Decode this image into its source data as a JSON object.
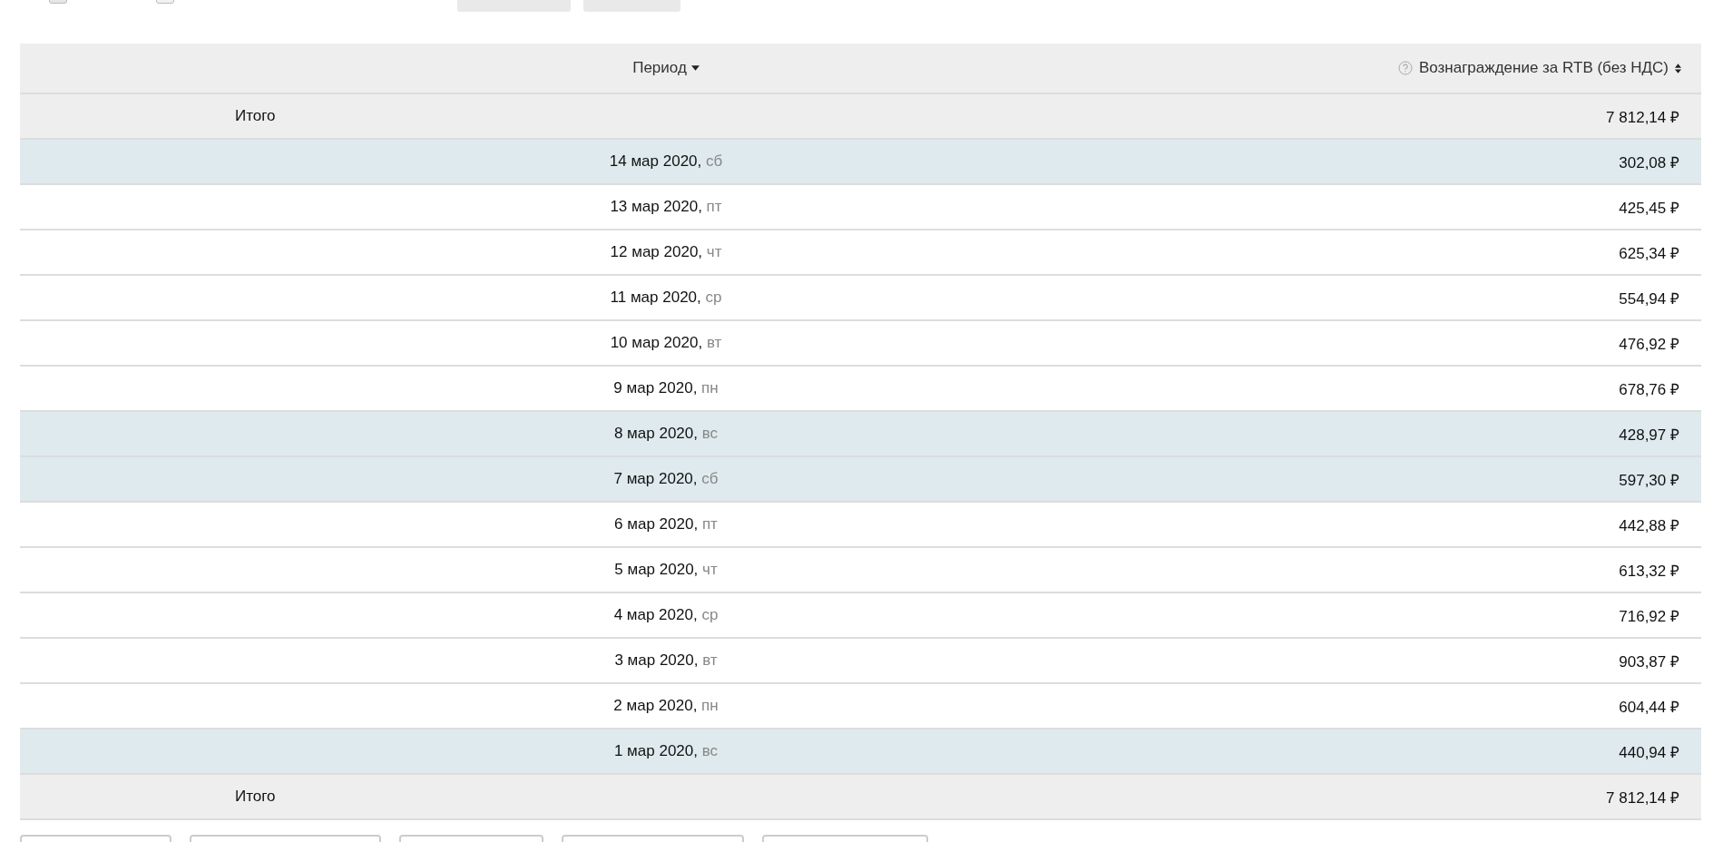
{
  "checkboxes": [
    {
      "checked": false
    },
    {
      "checked": false
    }
  ],
  "table": {
    "columns": [
      {
        "label": "Период",
        "sorted": true
      },
      {
        "label": "Вознаграждение за RTB (без НДС)",
        "sorted": false
      }
    ],
    "total_top": {
      "label": "Итого",
      "value": "7 812,14 ₽"
    },
    "rows": [
      {
        "date": "14 мар 2020,",
        "weekday": "сб",
        "value": "302,08 ₽",
        "highlighted": true
      },
      {
        "date": "13 мар 2020,",
        "weekday": "пт",
        "value": "425,45 ₽",
        "highlighted": false
      },
      {
        "date": "12 мар 2020,",
        "weekday": "чт",
        "value": "625,34 ₽",
        "highlighted": false
      },
      {
        "date": "11 мар 2020,",
        "weekday": "ср",
        "value": "554,94 ₽",
        "highlighted": false
      },
      {
        "date": "10 мар 2020,",
        "weekday": "вт",
        "value": "476,92 ₽",
        "highlighted": false
      },
      {
        "date": "9 мар 2020,",
        "weekday": "пн",
        "value": "678,76 ₽",
        "highlighted": false
      },
      {
        "date": "8 мар 2020,",
        "weekday": "вс",
        "value": "428,97 ₽",
        "highlighted": true
      },
      {
        "date": "7 мар 2020,",
        "weekday": "сб",
        "value": "597,30 ₽",
        "highlighted": true
      },
      {
        "date": "6 мар 2020,",
        "weekday": "пт",
        "value": "442,88 ₽",
        "highlighted": false
      },
      {
        "date": "5 мар 2020,",
        "weekday": "чт",
        "value": "613,32 ₽",
        "highlighted": false
      },
      {
        "date": "4 мар 2020,",
        "weekday": "ср",
        "value": "716,92 ₽",
        "highlighted": false
      },
      {
        "date": "3 мар 2020,",
        "weekday": "вт",
        "value": "903,87 ₽",
        "highlighted": false
      },
      {
        "date": "2 мар 2020,",
        "weekday": "пн",
        "value": "604,44 ₽",
        "highlighted": false
      },
      {
        "date": "1 мар 2020,",
        "weekday": "вс",
        "value": "440,94 ₽",
        "highlighted": true
      }
    ],
    "total_bottom": {
      "label": "Итого",
      "value": "7 812,14 ₽"
    }
  }
}
